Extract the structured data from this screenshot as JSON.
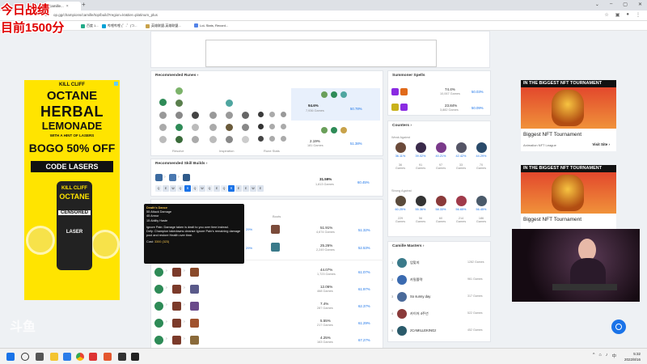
{
  "browser": {
    "tab_title": "Camille...",
    "url": "op.gg/champions/camille/top/build?region=kr&tier=platinum_plus",
    "bookmarks": [
      "百度 1...",
      "哔哩哔哩 (゜-゜)つ...",
      "英雄联盟-英雄联盟...",
      "LoL Stats, Record..."
    ]
  },
  "overlay": {
    "line1": "今日战绩",
    "line2": "目前1500分"
  },
  "ads": {
    "left": {
      "brand": "KILL CLIFF",
      "product": "OCTANE",
      "line1": "HERBAL",
      "line2": "LEMONADE",
      "line3": "WITH A HINT OF LASERS",
      "offer": "BOGO 50% OFF",
      "code_label": "CODE",
      "code": "LASERS",
      "can_brand": "KILL CLIFF",
      "can_name": "OCTANE",
      "can_tag": "CENSORED",
      "can_bottom": "LASER"
    },
    "right1": {
      "banner": "IN THE BIGGEST NFT TOURNAMENT",
      "title": "Biggest NFT Tournament",
      "advertiser": "Animalion NFT League",
      "cta": "Visit Site"
    },
    "right2": {
      "banner": "IN THE BIGGEST NFT TOURNAMENT",
      "title": "Biggest NFT Tournament"
    }
  },
  "runes": {
    "header": "Recommended Runes",
    "page_labels": [
      "Resolve",
      "Inspiration",
      "Rune Stats"
    ],
    "options": [
      {
        "pick": "94.6%",
        "games": "7,936 Games",
        "win": "50.78%"
      },
      {
        "pick": "2.19%",
        "games": "181 Games",
        "win": "51.38%"
      }
    ]
  },
  "skills": {
    "header": "Recommended Skill Builds",
    "keys": [
      "Q",
      "E",
      "W",
      "Q",
      "R",
      "Q",
      "W",
      "Q",
      "E",
      "Q",
      "R",
      "E",
      "E",
      "W",
      "E"
    ],
    "pick": "31.59%",
    "games": "1,813 Games",
    "win": "60.45%"
  },
  "items": {
    "boots_label": "Boots",
    "rows": [
      {
        "pick": "51.91%",
        "games": "4,674 Games",
        "win": "51.32%"
      },
      {
        "pick": "25.26%",
        "games": "2,249 Games",
        "win": "52.53%"
      }
    ],
    "side_vals": [
      "29%",
      "29%"
    ],
    "core_rows": [
      {
        "pick": "44.07%",
        "games": "1,723 Games",
        "win": "61.07%"
      },
      {
        "pick": "12.06%",
        "games": "468 Games",
        "win": "61.97%"
      },
      {
        "pick": "7.4%",
        "games": "287 Games",
        "win": "62.37%"
      },
      {
        "pick": "5.55%",
        "games": "217 Games",
        "win": "61.29%"
      },
      {
        "pick": "4.25%",
        "games": "163 Games",
        "win": "67.27%"
      }
    ]
  },
  "tooltip": {
    "name": "Death's Dance",
    "stats": [
      "55 Attack Damage",
      "45 Armor",
      "15 Ability Haste"
    ],
    "desc1": "Ignore Pain: Damage taken is dealt to you over time instead.",
    "desc2": "Defy: Champion takedowns cleanse Ignore Pain's remaining damage pool and restore Health over time.",
    "cost_label": "Cost:",
    "cost": "3300 (323)"
  },
  "spells": {
    "header": "Summoner Spells",
    "rows": [
      {
        "pick": "74.4%",
        "games": "10,067 Games",
        "win": "50.03%"
      },
      {
        "pick": "23.84%",
        "games": "3,882 Games",
        "win": "50.09%"
      }
    ]
  },
  "counters": {
    "header": "Counters",
    "weak_label": "Weak Against",
    "weak": [
      {
        "win": "36.11%",
        "games": "36",
        "label": "Games"
      },
      {
        "win": "39.02%",
        "games": "91",
        "label": "Games"
      },
      {
        "win": "40.21%",
        "games": "97",
        "label": "Games"
      },
      {
        "win": "42.42%",
        "games": "33",
        "label": "Games"
      },
      {
        "win": "44.29%",
        "games": "70",
        "label": "Games"
      }
    ],
    "strong_label": "Strong Against",
    "strong": [
      {
        "win": "60.25%",
        "games": "229",
        "label": "Games"
      },
      {
        "win": "55.36%",
        "games": "56",
        "label": "Games"
      },
      {
        "win": "58.33%",
        "games": "60",
        "label": "Games"
      },
      {
        "win": "56.65%",
        "games": "214",
        "label": "Games"
      },
      {
        "win": "56.45%",
        "games": "186",
        "label": "Games"
      }
    ]
  },
  "masters": {
    "header": "Camille Masters",
    "rows": [
      {
        "rank": "1",
        "name": "엄맞지",
        "games": "1282 Games"
      },
      {
        "rank": "2",
        "name": "카밀즐략",
        "games": "961 Games"
      },
      {
        "rank": "3",
        "name": "So sunny day",
        "games": "317 Games"
      },
      {
        "rank": "4",
        "name": "카이저 4주년",
        "games": "522 Games"
      },
      {
        "rank": "5",
        "name": "zCAMILLEKINGz",
        "games": "452 Games"
      }
    ]
  },
  "watermark": "斗鱼",
  "taskbar": {
    "time": "5:32",
    "date": "2022/8/16"
  }
}
